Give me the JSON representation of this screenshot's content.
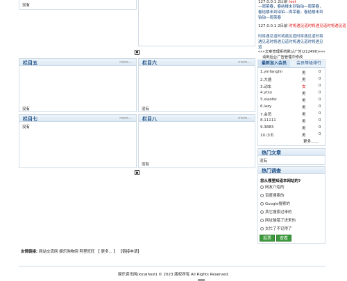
{
  "colors": {
    "header_text": "#1e4f86",
    "accent_red": "#dd1111",
    "button_green": "#3c9a3c"
  },
  "top": {
    "left_empty": "没有",
    "news": [
      {
        "meta": "127.0.0.1",
        "date": "2日前",
        "tag": "test"
      },
      {
        "text": "—周荣春，春结楼未到铂铂—周荣春，春结楼未到铂铂—周荣春，春结楼未到铂铂—周荣春"
      },
      {
        "meta": "127.0.0.1",
        "date": "2日前",
        "tag": "时将遇见道时将遇见道时将遇见道"
      },
      {
        "text": "时将遇见道时将遇见道时将遇见道时将遇见道时将遇见道时将遇见道时将遇见道"
      }
    ],
    "ad_line1": "«««文章管理系统默认广告(212490)»»»",
    "ad_line2": "请到后台广告管理中修改"
  },
  "columns": [
    {
      "title": "栏目五",
      "more": "more...",
      "empty": "没有"
    },
    {
      "title": "栏目六",
      "more": "more...",
      "empty": "没有"
    },
    {
      "title": "栏目七",
      "more": "more...",
      "empty": "没有"
    },
    {
      "title": "栏目八",
      "more": "more...",
      "empty": "没有"
    }
  ],
  "members": {
    "tab_new": "最新加入会员",
    "tab_rank": "会员等级排行",
    "rows": [
      {
        "name": "1.yinfanglin",
        "sex": "男",
        "count": "0"
      },
      {
        "name": "2.大德",
        "sex": "男",
        "count": "0"
      },
      {
        "name": "3.动车",
        "sex": "女",
        "count": "0"
      },
      {
        "name": "4.ytxy",
        "sex": "男",
        "count": "0"
      },
      {
        "name": "5.xiaofei",
        "sex": "男",
        "count": "0"
      },
      {
        "name": "6.lazy",
        "sex": "男",
        "count": "0"
      },
      {
        "name": "7.会员",
        "sex": "男",
        "count": "0"
      },
      {
        "name": "8.11111",
        "sex": "男",
        "count": "0"
      },
      {
        "name": "9.3883",
        "sex": "男",
        "count": "0"
      },
      {
        "name": "10.小五",
        "sex": "男",
        "count": "0"
      }
    ],
    "more": "更多......"
  },
  "hot_articles": {
    "title": "热门文章",
    "empty": "没有"
  },
  "poll": {
    "title": "热门调查",
    "question": "您从哪里知道本网站的?",
    "options": [
      "网友介绍的",
      "百度搜索的",
      "Google搜索的",
      "其它搜索过来的",
      "网址输错了进来的",
      "太忙了不记得了"
    ],
    "vote": "投票",
    "view": "查看"
  },
  "links": {
    "label": "友情链接:",
    "items": [
      "网站交流网",
      "娱乐购物网",
      "阿里旺旺"
    ],
    "more": "【 更多... 】",
    "apply": "【链接申请】"
  },
  "footer": {
    "copyright": "娱乐资讯网(localhost) © 2023 版权所有 All Rights Reserved."
  }
}
